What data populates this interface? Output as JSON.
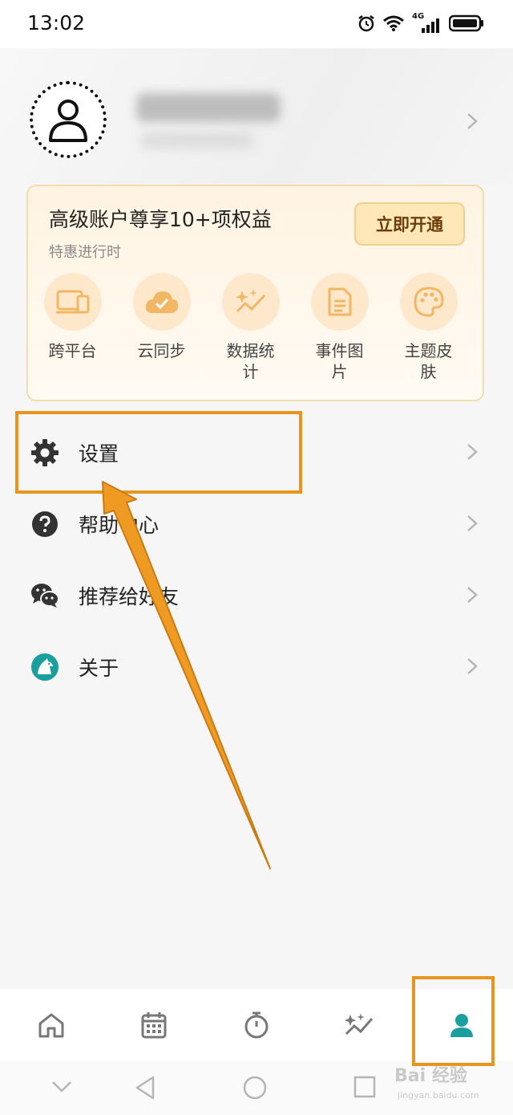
{
  "status_bar": {
    "time": "13:02",
    "network": "4G"
  },
  "premium": {
    "title": "高级账户尊享10+项权益",
    "subtitle": "特惠进行时",
    "open_button": "立即开通",
    "benefits": [
      {
        "label": "跨平台",
        "icon": "devices-icon"
      },
      {
        "label": "云同步",
        "icon": "cloud-sync-icon"
      },
      {
        "label": "数据统计",
        "icon": "sparkle-stats-icon"
      },
      {
        "label": "事件图片",
        "icon": "document-icon"
      },
      {
        "label": "主题皮肤",
        "icon": "palette-icon"
      }
    ]
  },
  "menu": [
    {
      "label": "设置",
      "icon": "gear-icon"
    },
    {
      "label": "帮助中心",
      "icon": "help-icon"
    },
    {
      "label": "推荐给好友",
      "icon": "wechat-icon"
    },
    {
      "label": "关于",
      "icon": "app-logo-icon"
    }
  ],
  "bottom_nav": [
    {
      "icon": "home-icon"
    },
    {
      "icon": "calendar-icon"
    },
    {
      "icon": "timer-icon"
    },
    {
      "icon": "stats-sparkle-icon"
    },
    {
      "icon": "profile-icon",
      "active": true
    }
  ],
  "watermark": {
    "text": "Bai 经验",
    "url": "jingyan.baidu.com"
  },
  "colors": {
    "accent": "#1a9e9e",
    "annotation": "#e8951e",
    "premium_bg": "#fff4e2",
    "benefit_icon": "#f1b765"
  }
}
